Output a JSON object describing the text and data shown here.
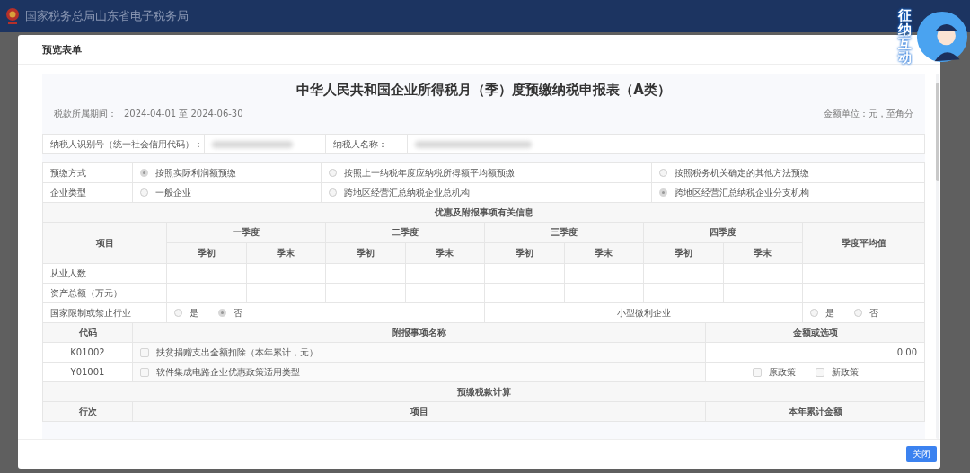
{
  "portal": {
    "title": "国家税务总局山东省电子税务局"
  },
  "assistant": {
    "label": "征纳互动"
  },
  "dialog": {
    "title": "预览表单",
    "close_button": "关闭"
  },
  "form": {
    "title": "中华人民共和国企业所得税月（季）度预缴纳税申报表（A类）",
    "period_label": "税款所属期间：",
    "period": "2024-04-01 至 2024-06-30",
    "unit": "金额单位：元，至角分",
    "taxpayer": [
      {
        "label": "纳税人识别号（统一社会信用代码）："
      },
      {
        "label": "纳税人名称："
      }
    ],
    "option_groups": [
      {
        "label": "预缴方式",
        "options": [
          {
            "label": "按照实际利润额预缴",
            "selected": true
          },
          {
            "label": "按照上一纳税年度应纳税所得额平均额预缴",
            "selected": false
          },
          {
            "label": "按照税务机关确定的其他方法预缴",
            "selected": false
          }
        ]
      },
      {
        "label": "企业类型",
        "options": [
          {
            "label": "一般企业",
            "selected": false
          },
          {
            "label": "跨地区经营汇总纳税企业总机构",
            "selected": false
          },
          {
            "label": "跨地区经营汇总纳税企业分支机构",
            "selected": true
          }
        ]
      }
    ],
    "info_section": {
      "title": "优惠及附报事项有关信息",
      "item_header": "项目",
      "quarters": [
        {
          "name": "一季度",
          "columns": [
            "季初",
            "季末"
          ]
        },
        {
          "name": "二季度",
          "columns": [
            "季初",
            "季末"
          ]
        },
        {
          "name": "三季度",
          "columns": [
            "季初",
            "季末"
          ]
        },
        {
          "name": "四季度",
          "columns": [
            "季初",
            "季末"
          ]
        }
      ],
      "average_header": "季度平均值",
      "rows": [
        {
          "label": "从业人数"
        },
        {
          "label": "资产总额（万元）"
        }
      ],
      "restricted": {
        "label": "国家限制或禁止行业",
        "options": [
          {
            "label": "是",
            "selected": false
          },
          {
            "label": "否",
            "selected": true
          }
        ]
      },
      "small_profit": {
        "label": "小型微利企业",
        "options": [
          {
            "label": "是",
            "selected": false
          },
          {
            "label": "否",
            "selected": false
          }
        ]
      }
    },
    "attachments": {
      "columns": [
        "代码",
        "附报事项名称",
        "金额或选项"
      ],
      "rows": [
        {
          "code": "K01002",
          "name": "扶贫捐赠支出全额扣除（本年累计，元）",
          "checked": false,
          "kind": "amount",
          "amount": "0.00"
        },
        {
          "code": "Y01001",
          "name": "软件集成电路企业优惠政策适用类型",
          "checked": false,
          "kind": "choices",
          "choices": [
            {
              "label": "原政策",
              "checked": false
            },
            {
              "label": "新政策",
              "checked": false
            }
          ]
        }
      ]
    },
    "calc_section": {
      "title": "预缴税款计算",
      "columns": [
        "行次",
        "项目",
        "本年累计金额"
      ]
    }
  }
}
